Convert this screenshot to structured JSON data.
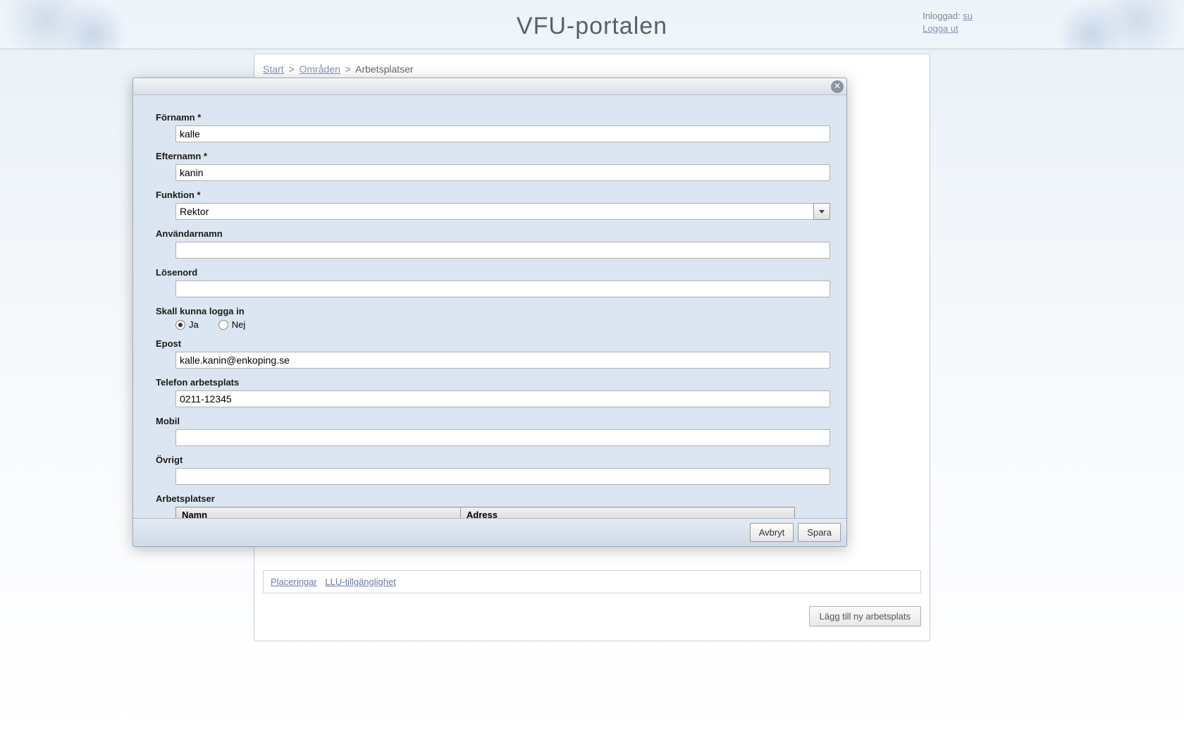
{
  "header": {
    "title": "VFU-portalen",
    "logged_in_label": "Inloggad:",
    "user_link": "su",
    "logout": "Logga ut"
  },
  "breadcrumb": {
    "items": [
      {
        "label": "Start",
        "link": true
      },
      {
        "label": "Områden",
        "link": true
      },
      {
        "label": "Arbetsplatser",
        "link": false
      }
    ]
  },
  "bottom_links": {
    "placeringar": "Placeringar",
    "llu": "LLU-tillgänglighet"
  },
  "add_workplace_button": "Lägg till ny arbetsplats",
  "modal": {
    "fields": {
      "fornamn": {
        "label": "Förnamn *",
        "value": "kalle"
      },
      "efternamn": {
        "label": "Efternamn *",
        "value": "kanin"
      },
      "funktion": {
        "label": "Funktion *",
        "value": "Rektor"
      },
      "anvandarnamn": {
        "label": "Användarnamn",
        "value": ""
      },
      "losenord": {
        "label": "Lösenord",
        "value": ""
      },
      "login": {
        "label": "Skall kunna logga in",
        "ja": "Ja",
        "nej": "Nej",
        "selected": "ja"
      },
      "epost": {
        "label": "Epost",
        "value": "kalle.kanin@enkoping.se"
      },
      "telefon": {
        "label": "Telefon arbetsplats",
        "value": "0211-12345"
      },
      "mobil": {
        "label": "Mobil",
        "value": ""
      },
      "ovrigt": {
        "label": "Övrigt",
        "value": ""
      },
      "arbetsplatser": {
        "label": "Arbetsplatser",
        "col_namn": "Namn",
        "col_adress": "Adress"
      }
    },
    "buttons": {
      "cancel": "Avbryt",
      "save": "Spara"
    }
  }
}
